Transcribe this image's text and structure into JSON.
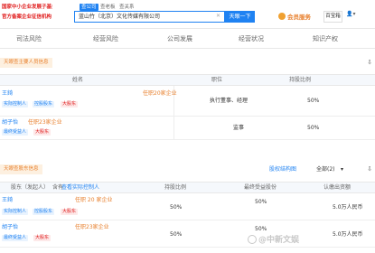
{
  "promo": {
    "line1": "国家中小企业发展子基金旗下",
    "line2": "官方备案企业征信机构"
  },
  "search_tabs": [
    "查公司",
    "查老板",
    "查关系"
  ],
  "search": {
    "value": "蓝山竹（北京）文化传媒有限公司",
    "button": "天眼一下"
  },
  "vip_label": "会员服务",
  "badge": "百宝箱",
  "nav": [
    "司法风险",
    "经营风险",
    "公司发展",
    "经营状况",
    "知识产权"
  ],
  "section1": {
    "tab": "天眼查主要人员信息",
    "headers": [
      "姓名",
      "职位",
      "持股比例"
    ],
    "rows": [
      {
        "name": "王錡",
        "count": "任职20家企业",
        "tags": [
          "实际控制人",
          "控股股东",
          "大股东"
        ],
        "position": "执行董事、经理",
        "ratio": "50%"
      },
      {
        "name": "胡子怡",
        "count": "任职23家企业",
        "tags": [
          "最终受益人",
          "大股东"
        ],
        "position": "监事",
        "ratio": "50%"
      }
    ]
  },
  "section2": {
    "tab": "天眼查股东信息",
    "history": "股权结构图",
    "filter": "全部(2)",
    "headers": [
      "股东（发起人）",
      "含有",
      "查看实际控制人",
      "持股比例",
      "最终受益股份",
      "认缴出资额"
    ],
    "rows": [
      {
        "name": "王錡",
        "count": "任职 20 家企业",
        "tags": [
          "实际控制人",
          "控股股东",
          "大股东"
        ],
        "ratio": "50%",
        "benefit": "50%",
        "amount": "5.0万人民币"
      },
      {
        "name": "胡子怡",
        "count": "任职23家企业",
        "tags": [
          "最终受益人",
          "大股东"
        ],
        "ratio": "50%",
        "benefit": "50%",
        "amount": "5.0万人民币"
      }
    ]
  },
  "watermark": "@中新文娱"
}
